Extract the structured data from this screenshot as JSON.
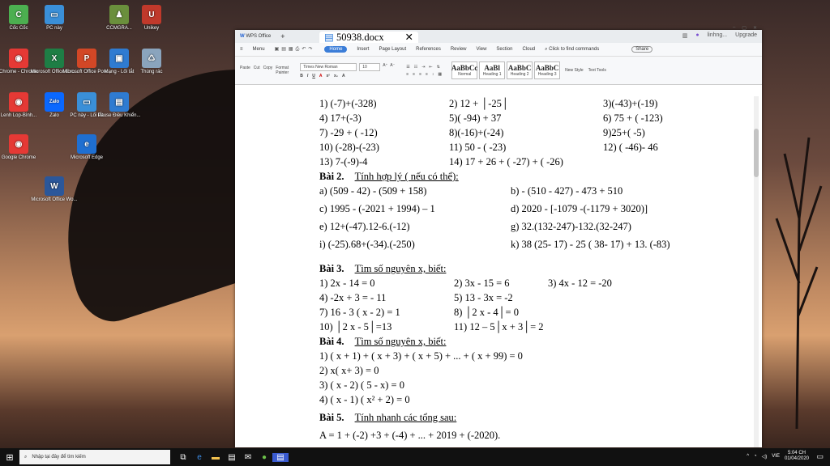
{
  "desktop": {
    "icons": [
      {
        "label": "Cốc Cốc",
        "glyph": "C",
        "color": "#4caf50",
        "icon": "coccoc-icon"
      },
      {
        "label": "PC này",
        "glyph": "▭",
        "color": "#3a8fd8",
        "icon": "pc-icon"
      },
      {
        "label": "CCMGRA...",
        "glyph": "♟",
        "color": "#6a8f3c",
        "icon": "user-folder-icon"
      },
      {
        "label": "Unikey",
        "glyph": "U",
        "color": "#c0392b",
        "icon": "unikey-icon"
      },
      {
        "label": "Chrome - Chrome",
        "glyph": "◉",
        "color": "#e53935",
        "icon": "chrome-icon"
      },
      {
        "label": "Microsoft Office Exc...",
        "glyph": "X",
        "color": "#1e7e45",
        "icon": "excel-icon"
      },
      {
        "label": "Microsoft Office Pow...",
        "glyph": "P",
        "color": "#d24726",
        "icon": "powerpoint-icon"
      },
      {
        "label": "Mạng - Lối tắt",
        "glyph": "▣",
        "color": "#2f7bd1",
        "icon": "network-icon"
      },
      {
        "label": "Thùng rác",
        "glyph": "♺",
        "color": "#8aa4bd",
        "icon": "recycle-bin-icon"
      },
      {
        "label": "Lenh Lop-Bình...",
        "glyph": "◉",
        "color": "#e53935",
        "icon": "chrome-profile-icon"
      },
      {
        "label": "Zalo",
        "glyph": "Zalo",
        "color": "#0a68ff",
        "icon": "zalo-icon"
      },
      {
        "label": "PC này - Lối tắt",
        "glyph": "▭",
        "color": "#3a8fd8",
        "icon": "pc-shortcut-icon"
      },
      {
        "label": "Pause Điều Khiển...",
        "glyph": "▤",
        "color": "#2f7bd1",
        "icon": "remote-icon"
      },
      {
        "label": "Google Chrome",
        "glyph": "◉",
        "color": "#e53935",
        "icon": "google-chrome-icon"
      },
      {
        "label": "Microsoft Edge",
        "glyph": "e",
        "color": "#1f6fd1",
        "icon": "edge-icon"
      },
      {
        "label": "Microsoft Office Wo...",
        "glyph": "W",
        "color": "#2b579a",
        "icon": "word-icon"
      }
    ]
  },
  "window": {
    "app_tab": "WPS Office",
    "doc_tab": "50938.docx",
    "user": "linhng...",
    "upgrade": "Upgrade",
    "menu": [
      "Menu",
      "Home",
      "Insert",
      "Page Layout",
      "References",
      "Review",
      "View",
      "Section",
      "Cloud"
    ],
    "search_commands": "Click to find commands",
    "share": "Share",
    "font_name": "Times New Roman",
    "font_size": "10",
    "styles": [
      {
        "sample": "AaBbCc",
        "name": "Normal"
      },
      {
        "sample": "AaBl",
        "name": "Heading 1"
      },
      {
        "sample": "AaBbC",
        "name": "Heading 2"
      },
      {
        "sample": "AaBbC",
        "name": "Heading 3"
      }
    ],
    "new_style": "New Style",
    "text_tools": "Text Tools",
    "paste": "Paste",
    "copy": "Copy",
    "format_painter": "Format Painter",
    "cut": "Cut"
  },
  "document": {
    "lines": [
      {
        "cols": [
          "1) (-7)+(-328)",
          "2) 12 + │-25│",
          "3)(-43)+(-19)"
        ]
      },
      {
        "cols": [
          "4) 17+(-3)",
          "5)( -94) + 37",
          "6) 75 + ( -123)"
        ]
      },
      {
        "cols": [
          "7) -29 + ( -12)",
          "8)(-16)+(-24)",
          "9)25+( -5)"
        ]
      },
      {
        "cols": [
          "10) (-28)-(-23)",
          "11) 50 - ( -23)",
          "12) ( -46)- 46"
        ]
      },
      {
        "cols": [
          "13) 7-(-9)-4",
          "14) 17 + 26 + ( -27) + ( -26)",
          ""
        ]
      }
    ],
    "bai2_title": "Bài 2.",
    "bai2_text": "Tính hợp lý ( nếu có thể):",
    "bai2": [
      [
        "a) (509 - 42) - (509 + 158)",
        "b) - (510 - 427) - 473 + 510"
      ],
      [
        "c) 1995 - (-2021 + 1994) – 1",
        "d) 2020 - [-1079 -(-1179 + 3020)]"
      ],
      [
        "e) 12+(-47).12-6.(-12)",
        "g) 32.(132-247)-132.(32-247)"
      ],
      [
        "i) (-25).68+(-34).(-250)",
        "k) 38 (25- 17) - 25 ( 38- 17) + 13. (-83)"
      ]
    ],
    "bai3_title": "Bài 3.",
    "bai3_text": "Tìm số nguyên x, biết:",
    "bai3": [
      [
        "1) 2x - 14 = 0",
        "2) 3x - 15 = 6",
        "3) 4x - 12 = -20"
      ],
      [
        "4) -2x + 3 = - 11",
        "5) 13 - 3x = -2",
        ""
      ],
      [
        "7) 16 - 3 ( x - 2) = 1",
        "8) │2 x - 4│= 0",
        ""
      ],
      [
        "10) │2 x - 5│=13",
        "11) 12 – 5│x + 3│= 2",
        ""
      ]
    ],
    "bai4_title": "Bài 4.",
    "bai4_text": "Tìm số nguyên x, biết:",
    "bai4": [
      "1) ( x + 1) + ( x + 3) + ( x + 5) + ... + ( x + 99) = 0",
      "2) x( x+ 3) = 0",
      "3) ( x - 2) ( 5 - x) = 0",
      "4) ( x - 1) ( x² + 2) = 0"
    ],
    "bai5_title": "Bài 5.",
    "bai5_text": "Tính nhanh các tổng sau:",
    "bai5": [
      "A = 1 + (-2) +3 + (-4) + ... + 2019 + (-2020)."
    ]
  },
  "taskbar": {
    "search_placeholder": "Nhập tại đây để tìm kiếm",
    "lang": "VIE",
    "time": "5:04 CH",
    "date": "01/04/2020"
  }
}
